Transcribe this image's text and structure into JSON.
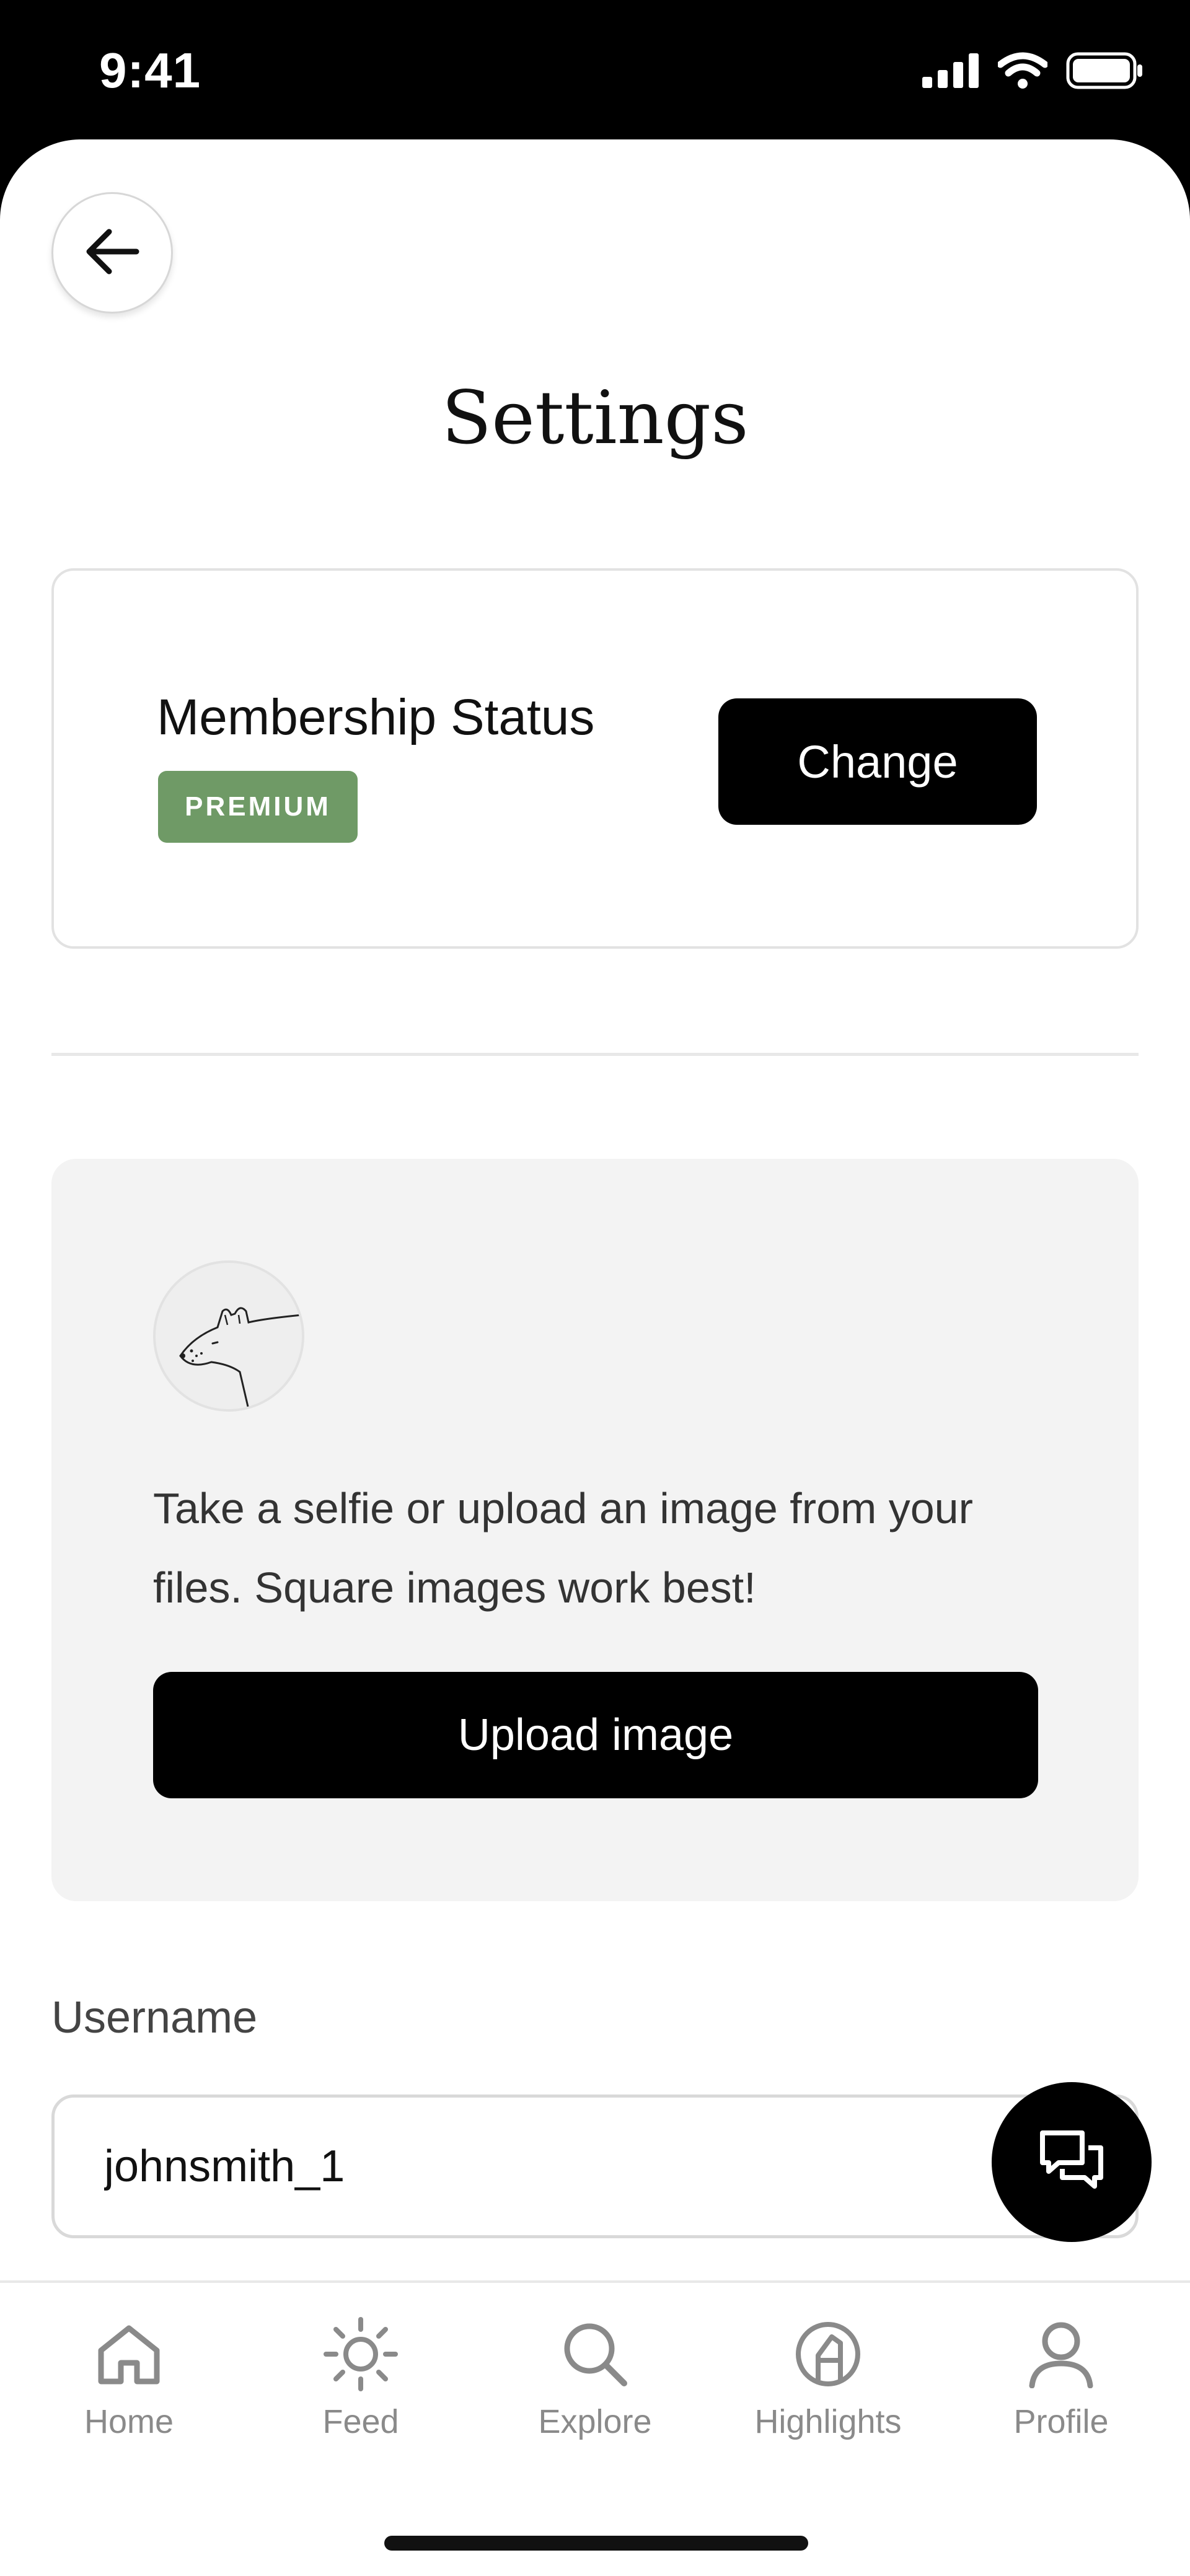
{
  "status_bar": {
    "time": "9:41",
    "icons": [
      "signal-icon",
      "wifi-icon",
      "battery-icon"
    ]
  },
  "header": {
    "back_icon": "arrow-left-icon",
    "title": "Settings"
  },
  "membership": {
    "label": "Membership Status",
    "badge": "PREMIUM",
    "badge_color": "#6f9a66",
    "button_label": "Change"
  },
  "upload": {
    "avatar_icon": "hyena-sketch-avatar",
    "description": "Take a selfie or upload an image from your files. Square images work best!",
    "button_label": "Upload image"
  },
  "username": {
    "label": "Username",
    "value": "johnsmith_1"
  },
  "chat_button": {
    "icon": "chat-bubbles-icon"
  },
  "tab_bar": {
    "items": [
      {
        "label": "Home",
        "icon": "home-icon"
      },
      {
        "label": "Feed",
        "icon": "sun-icon"
      },
      {
        "label": "Explore",
        "icon": "search-icon"
      },
      {
        "label": "Highlights",
        "icon": "highlighter-icon"
      },
      {
        "label": "Profile",
        "icon": "person-icon"
      }
    ]
  },
  "colors": {
    "primary_button": "#000000",
    "tab_inactive": "#8a8a8a",
    "card_background": "#f3f3f3"
  }
}
